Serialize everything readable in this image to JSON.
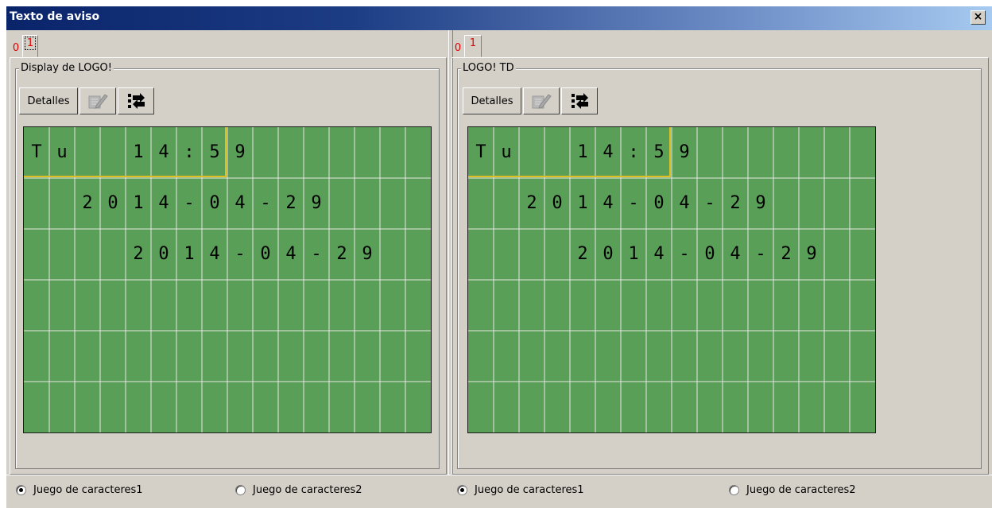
{
  "window": {
    "title": "Texto de aviso",
    "close_label": "×"
  },
  "left": {
    "tabs": [
      "0",
      "1"
    ],
    "active_tab": "1",
    "group_label": "Display de LOGO!",
    "details_label": "Detalles",
    "edit_icon": "edit-icon",
    "nav_icon": "arrows-icon",
    "lcd": {
      "color": "#599f57",
      "rows": [
        [
          "T",
          "u",
          " ",
          " ",
          "1",
          "4",
          ":",
          "5",
          "9",
          " ",
          " ",
          " ",
          " ",
          " ",
          " ",
          " "
        ],
        [
          " ",
          " ",
          "2",
          "0",
          "1",
          "4",
          "-",
          "0",
          "4",
          "-",
          "2",
          "9",
          " ",
          " ",
          " ",
          " "
        ],
        [
          " ",
          " ",
          " ",
          " ",
          "2",
          "0",
          "1",
          "4",
          "-",
          "0",
          "4",
          "-",
          "2",
          "9",
          " ",
          " "
        ],
        [
          " ",
          " ",
          " ",
          " ",
          " ",
          " ",
          " ",
          " ",
          " ",
          " ",
          " ",
          " ",
          " ",
          " ",
          " ",
          " "
        ],
        [
          " ",
          " ",
          " ",
          " ",
          " ",
          " ",
          " ",
          " ",
          " ",
          " ",
          " ",
          " ",
          " ",
          " ",
          " ",
          " "
        ],
        [
          " ",
          " ",
          " ",
          " ",
          " ",
          " ",
          " ",
          " ",
          " ",
          " ",
          " ",
          " ",
          " ",
          " ",
          " ",
          " "
        ]
      ]
    },
    "radio1": "Juego de caracteres1",
    "radio2": "Juego de caracteres2",
    "radio_selected": 1
  },
  "right": {
    "tabs": [
      "0",
      "1"
    ],
    "active_tab": "1",
    "group_label": "LOGO! TD",
    "details_label": "Detalles",
    "edit_icon": "edit-icon",
    "nav_icon": "arrows-icon",
    "lcd": {
      "color": "#599f57",
      "rows": [
        [
          "T",
          "u",
          " ",
          " ",
          "1",
          "4",
          ":",
          "5",
          "9",
          " ",
          " ",
          " ",
          " ",
          " ",
          " ",
          " "
        ],
        [
          " ",
          " ",
          "2",
          "0",
          "1",
          "4",
          "-",
          "0",
          "4",
          "-",
          "2",
          "9",
          " ",
          " ",
          " ",
          " "
        ],
        [
          " ",
          " ",
          " ",
          " ",
          "2",
          "0",
          "1",
          "4",
          "-",
          "0",
          "4",
          "-",
          "2",
          "9",
          " ",
          " "
        ],
        [
          " ",
          " ",
          " ",
          " ",
          " ",
          " ",
          " ",
          " ",
          " ",
          " ",
          " ",
          " ",
          " ",
          " ",
          " ",
          " "
        ],
        [
          " ",
          " ",
          " ",
          " ",
          " ",
          " ",
          " ",
          " ",
          " ",
          " ",
          " ",
          " ",
          " ",
          " ",
          " ",
          " "
        ],
        [
          " ",
          " ",
          " ",
          " ",
          " ",
          " ",
          " ",
          " ",
          " ",
          " ",
          " ",
          " ",
          " ",
          " ",
          " ",
          " "
        ]
      ]
    },
    "radio1": "Juego de caracteres1",
    "radio2": "Juego de caracteres2",
    "radio_selected": 1
  }
}
